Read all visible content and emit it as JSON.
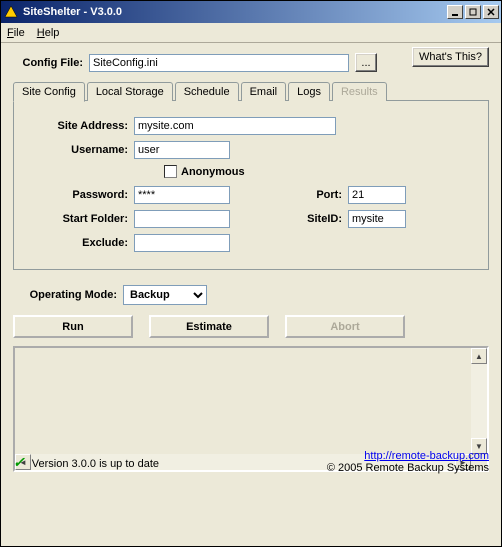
{
  "window": {
    "title": "SiteShelter - V3.0.0"
  },
  "menu": {
    "file": "File",
    "help": "Help"
  },
  "config": {
    "label": "Config File:",
    "value": "SiteConfig.ini",
    "browse": "..."
  },
  "whats_this": "What's This?",
  "tabs": {
    "site": "Site Config",
    "local": "Local Storage",
    "schedule": "Schedule",
    "email": "Email",
    "logs": "Logs",
    "results": "Results"
  },
  "site": {
    "address_label": "Site Address:",
    "address": "mysite.com",
    "username_label": "Username:",
    "username": "user",
    "anonymous": "Anonymous",
    "password_label": "Password:",
    "password": "****",
    "port_label": "Port:",
    "port": "21",
    "startfolder_label": "Start Folder:",
    "startfolder": "",
    "siteid_label": "SiteID:",
    "siteid": "mysite",
    "exclude_label": "Exclude:",
    "exclude": ""
  },
  "mode": {
    "label": "Operating Mode:",
    "value": "Backup"
  },
  "actions": {
    "run": "Run",
    "estimate": "Estimate",
    "abort": "Abort"
  },
  "footer": {
    "status": "Version 3.0.0 is up to date",
    "link": "http://remote-backup.com",
    "copyright": "© 2005 Remote Backup Systems"
  }
}
